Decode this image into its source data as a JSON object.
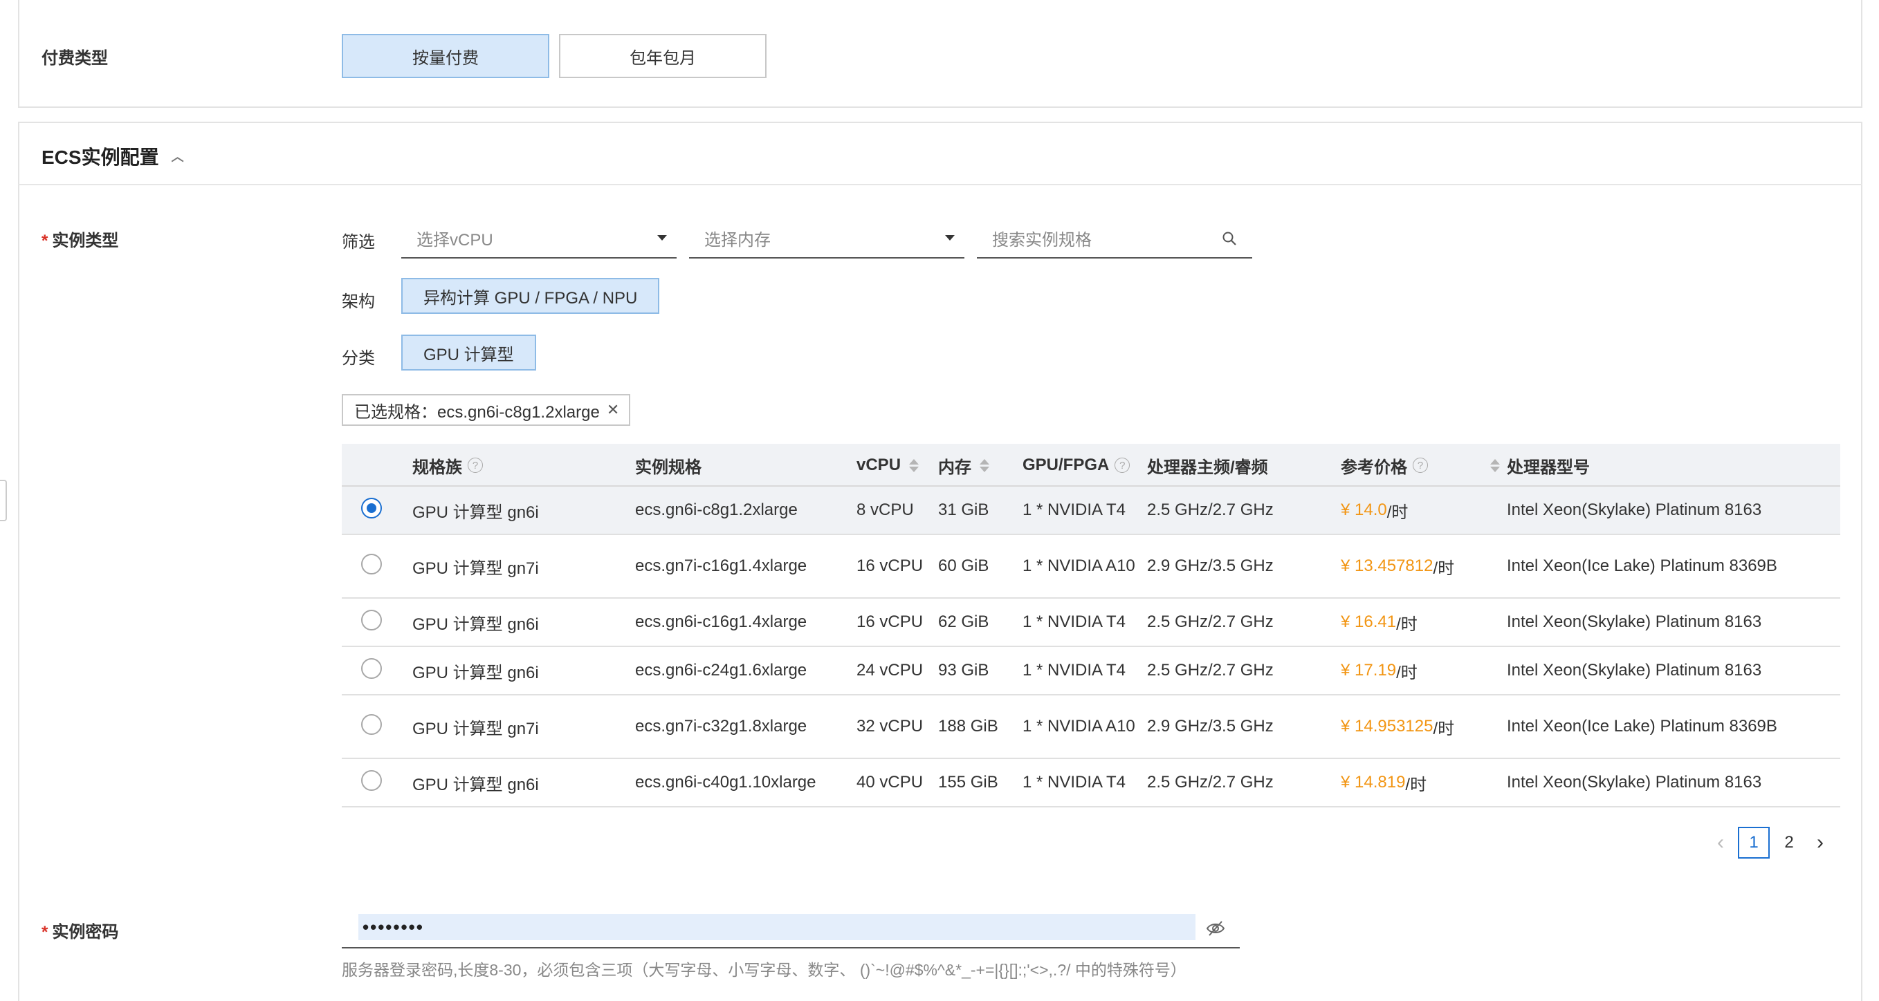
{
  "payment": {
    "label": "付费类型",
    "options": [
      "按量付费",
      "包年包月"
    ],
    "selected": "按量付费"
  },
  "ecs": {
    "section_title": "ECS实例配置",
    "instance_type": {
      "label": "实例类型",
      "required_mark": "*",
      "filter": {
        "label": "筛选",
        "vcpu_placeholder": "选择vCPU",
        "memory_placeholder": "选择内存",
        "search_placeholder": "搜索实例规格"
      },
      "arch": {
        "label": "架构",
        "value": "异构计算 GPU / FPGA / NPU"
      },
      "category": {
        "label": "分类",
        "value": "GPU 计算型"
      },
      "selected_tag": "已选规格：ecs.gn6i-c8g1.2xlarge",
      "table": {
        "headers": {
          "family": "规格族",
          "spec": "实例规格",
          "vcpu": "vCPU",
          "memory": "内存",
          "gpu": "GPU/FPGA",
          "freq": "处理器主频/睿频",
          "price": "参考价格",
          "cpu_model": "处理器型号"
        },
        "rows": [
          {
            "family": "GPU 计算型 gn6i",
            "spec": "ecs.gn6i-c8g1.2xlarge",
            "vcpu": "8 vCPU",
            "memory": "31 GiB",
            "gpu": "1 * NVIDIA T4",
            "freq": "2.5 GHz/2.7 GHz",
            "price": "¥ 14.0",
            "unit": "/时",
            "cpu_model": "Intel Xeon(Skylake) Platinum 8163",
            "selected": true
          },
          {
            "family": "GPU 计算型 gn7i",
            "spec": "ecs.gn7i-c16g1.4xlarge",
            "vcpu": "16 vCPU",
            "memory": "60 GiB",
            "gpu": "1 * NVIDIA A10",
            "freq": "2.9 GHz/3.5 GHz",
            "price": "¥ 13.457812",
            "unit": "/时",
            "cpu_model": "Intel Xeon(Ice Lake) Platinum 8369B",
            "selected": false
          },
          {
            "family": "GPU 计算型 gn6i",
            "spec": "ecs.gn6i-c16g1.4xlarge",
            "vcpu": "16 vCPU",
            "memory": "62 GiB",
            "gpu": "1 * NVIDIA T4",
            "freq": "2.5 GHz/2.7 GHz",
            "price": "¥ 16.41",
            "unit": "/时",
            "cpu_model": "Intel Xeon(Skylake) Platinum 8163",
            "selected": false
          },
          {
            "family": "GPU 计算型 gn6i",
            "spec": "ecs.gn6i-c24g1.6xlarge",
            "vcpu": "24 vCPU",
            "memory": "93 GiB",
            "gpu": "1 * NVIDIA T4",
            "freq": "2.5 GHz/2.7 GHz",
            "price": "¥ 17.19",
            "unit": "/时",
            "cpu_model": "Intel Xeon(Skylake) Platinum 8163",
            "selected": false
          },
          {
            "family": "GPU 计算型 gn7i",
            "spec": "ecs.gn7i-c32g1.8xlarge",
            "vcpu": "32 vCPU",
            "memory": "188 GiB",
            "gpu": "1 * NVIDIA A10",
            "freq": "2.9 GHz/3.5 GHz",
            "price": "¥ 14.953125",
            "unit": "/时",
            "cpu_model": "Intel Xeon(Ice Lake) Platinum 8369B",
            "selected": false
          },
          {
            "family": "GPU 计算型 gn6i",
            "spec": "ecs.gn6i-c40g1.10xlarge",
            "vcpu": "40 vCPU",
            "memory": "155 GiB",
            "gpu": "1 * NVIDIA T4",
            "freq": "2.5 GHz/2.7 GHz",
            "price": "¥ 14.819",
            "unit": "/时",
            "cpu_model": "Intel Xeon(Skylake) Platinum 8163",
            "selected": false
          }
        ]
      },
      "pagination": {
        "pages": [
          "1",
          "2"
        ],
        "current": "1",
        "prev": "‹",
        "next": "›"
      }
    },
    "password": {
      "label": "实例密码",
      "required_mark": "*",
      "value": "••••••••",
      "hint": "服务器登录密码,长度8-30，必须包含三项（大写字母、小写字母、数字、 ()`~!@#$%^&*_-+=|{}[]:;'<>,.?/ 中的特殊符号）"
    }
  },
  "colors": {
    "accent": "#1a6fd1",
    "price": "#f29513",
    "selected_bg": "#d7e8fa",
    "required": "#d93026"
  }
}
